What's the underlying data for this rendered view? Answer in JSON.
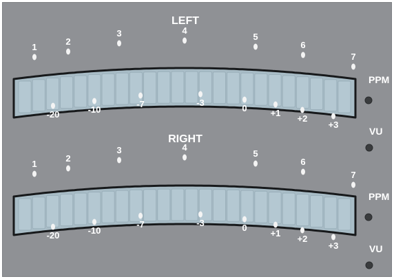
{
  "meters": [
    {
      "title": "LEFT",
      "ppm_scale": [
        "1",
        "2",
        "3",
        "4",
        "5",
        "6",
        "7"
      ],
      "vu_scale": [
        "-20",
        "-10",
        "-7",
        "-3",
        "0",
        "+1",
        "+2",
        "+3"
      ],
      "ppm_label": "PPM",
      "vu_label": "VU"
    },
    {
      "title": "RIGHT",
      "ppm_scale": [
        "1",
        "2",
        "3",
        "4",
        "5",
        "6",
        "7"
      ],
      "vu_scale": [
        "-20",
        "-10",
        "-7",
        "-3",
        "0",
        "+1",
        "+2",
        "+3"
      ],
      "ppm_label": "PPM",
      "vu_label": "VU"
    }
  ],
  "colors": {
    "panel": "#8f9195",
    "display_fill": "#a8bcc6",
    "segment_fill": "#b4c8d2",
    "display_border": "#17191b",
    "indicator_led": "#3a3c3e",
    "markings": "#ffffff"
  },
  "segments_per_meter": 24
}
